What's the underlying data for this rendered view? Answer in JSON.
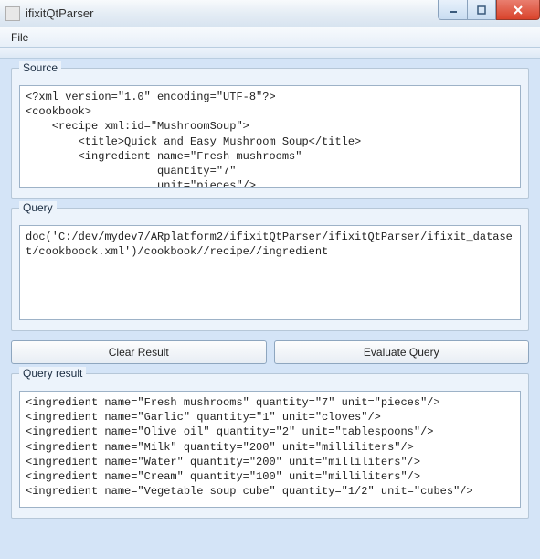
{
  "window": {
    "title": "ifixitQtParser"
  },
  "menu": {
    "file": "File"
  },
  "labels": {
    "source": "Source",
    "query": "Query",
    "result": "Query result"
  },
  "text": {
    "source": "<?xml version=\"1.0\" encoding=\"UTF-8\"?>\n<cookbook>\n    <recipe xml:id=\"MushroomSoup\">\n        <title>Quick and Easy Mushroom Soup</title>\n        <ingredient name=\"Fresh mushrooms\"\n                    quantity=\"7\"\n                    unit=\"pieces\"/>",
    "query": "doc('C:/dev/mydev7/ARplatform2/ifixitQtParser/ifixitQtParser/ifixit_dataset/cookboook.xml')/cookbook//recipe//ingredient",
    "result": "<ingredient name=\"Fresh mushrooms\" quantity=\"7\" unit=\"pieces\"/>\n<ingredient name=\"Garlic\" quantity=\"1\" unit=\"cloves\"/>\n<ingredient name=\"Olive oil\" quantity=\"2\" unit=\"tablespoons\"/>\n<ingredient name=\"Milk\" quantity=\"200\" unit=\"milliliters\"/>\n<ingredient name=\"Water\" quantity=\"200\" unit=\"milliliters\"/>\n<ingredient name=\"Cream\" quantity=\"100\" unit=\"milliliters\"/>\n<ingredient name=\"Vegetable soup cube\" quantity=\"1/2\" unit=\"cubes\"/>"
  },
  "buttons": {
    "clear": "Clear Result",
    "evaluate": "Evaluate Query"
  }
}
